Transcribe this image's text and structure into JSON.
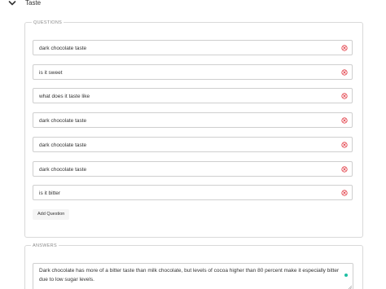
{
  "section": {
    "title": "Taste",
    "collapse_icon": "chevron-down-icon"
  },
  "questions_group": {
    "legend": "QUESTIONS",
    "items": [
      "dark chocolate taste",
      "is it sweet",
      "what does it taste like",
      "dark chocolate taste",
      "dark chocolate taste",
      "dark chocolate taste",
      "is it bitter"
    ],
    "clear_icon": "remove-circle-icon",
    "clear_color": "#e0303a",
    "add_label": "Add Question"
  },
  "answers_group": {
    "legend": "ANSWERS",
    "text": "Dark chocolate has more of a bitter taste than milk chocolate, but levels of cocoa higher than 80 percent make it especially bitter due to low sugar levels.",
    "status_color": "#1fbfa3"
  }
}
